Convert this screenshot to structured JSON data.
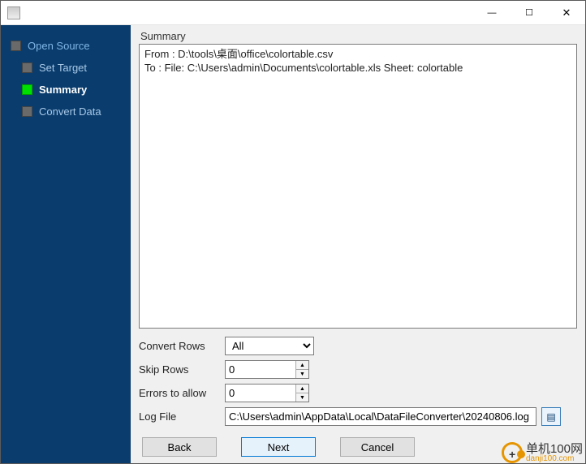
{
  "window": {
    "minimize_glyph": "—",
    "maximize_glyph": "☐",
    "close_glyph": "✕"
  },
  "sidebar": {
    "steps": [
      {
        "label": "Open Source"
      },
      {
        "label": "Set Target"
      },
      {
        "label": "Summary"
      },
      {
        "label": "Convert Data"
      }
    ]
  },
  "main": {
    "summary_heading": "Summary",
    "summary_lines": "From : D:\\tools\\桌面\\office\\colortable.csv\nTo : File: C:\\Users\\admin\\Documents\\colortable.xls Sheet: colortable",
    "options": {
      "convert_rows_label": "Convert Rows",
      "convert_rows_value": "All",
      "skip_rows_label": "Skip Rows",
      "skip_rows_value": "0",
      "errors_label": "Errors to allow",
      "errors_value": "0",
      "logfile_label": "Log File",
      "logfile_value": "C:\\Users\\admin\\AppData\\Local\\DataFileConverter\\20240806.log"
    },
    "buttons": {
      "back": "Back",
      "next": "Next",
      "cancel": "Cancel"
    }
  },
  "watermark": {
    "cn": "单机100网",
    "en": "danji100.com"
  }
}
